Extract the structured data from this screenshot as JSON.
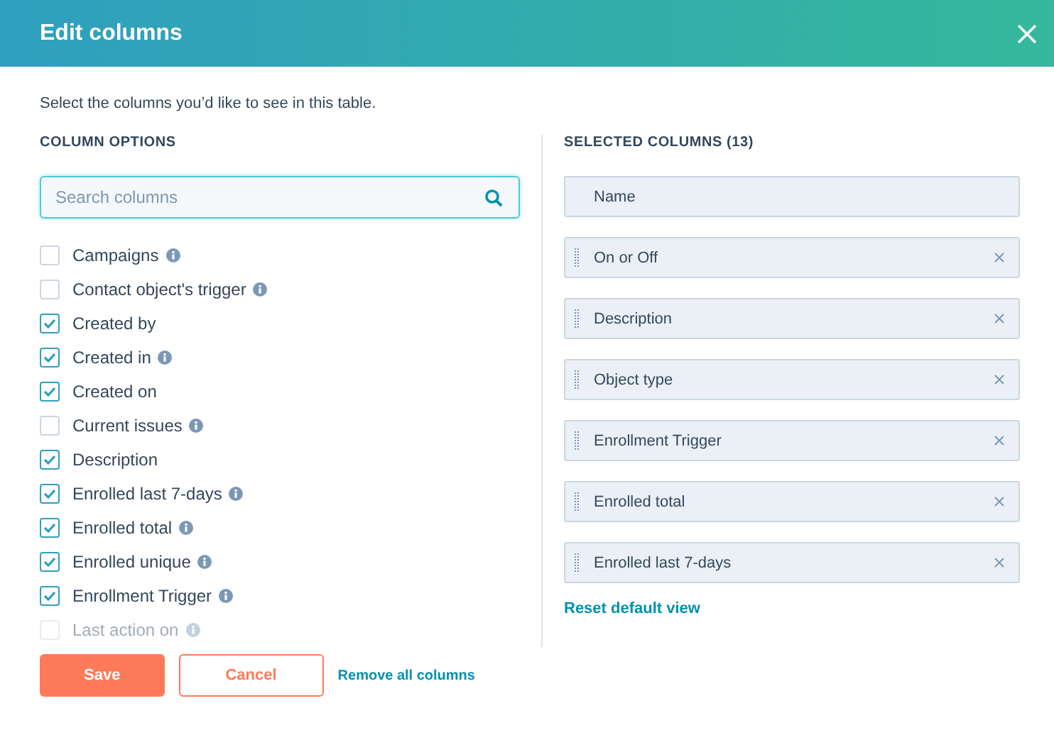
{
  "window": {
    "title": "Edit columns"
  },
  "intro": "Select the columns you’d like to see in this table.",
  "options": {
    "heading": "COLUMN OPTIONS",
    "search": {
      "placeholder": "Search columns"
    },
    "items": [
      {
        "label": "Campaigns",
        "checked": false,
        "info": true
      },
      {
        "label": "Contact object's trigger",
        "checked": false,
        "info": true
      },
      {
        "label": "Created by",
        "checked": true,
        "info": false
      },
      {
        "label": "Created in",
        "checked": true,
        "info": true
      },
      {
        "label": "Created on",
        "checked": true,
        "info": false
      },
      {
        "label": "Current issues",
        "checked": false,
        "info": true
      },
      {
        "label": "Description",
        "checked": true,
        "info": false
      },
      {
        "label": "Enrolled last 7-days",
        "checked": true,
        "info": true
      },
      {
        "label": "Enrolled total",
        "checked": true,
        "info": true
      },
      {
        "label": "Enrolled unique",
        "checked": true,
        "info": true
      },
      {
        "label": "Enrollment Trigger",
        "checked": true,
        "info": true
      },
      {
        "label": "Last action on",
        "checked": false,
        "info": true
      }
    ]
  },
  "selected": {
    "heading": "SELECTED COLUMNS (13)",
    "items": [
      {
        "label": "Name",
        "kind": "fixed"
      },
      {
        "label": "On or Off",
        "kind": "movable"
      },
      {
        "label": "Description",
        "kind": "movable"
      },
      {
        "label": "Object type",
        "kind": "movable"
      },
      {
        "label": "Enrollment Trigger",
        "kind": "movable"
      },
      {
        "label": "Enrolled total",
        "kind": "movable"
      },
      {
        "label": "Enrolled last 7-days",
        "kind": "movable"
      }
    ],
    "reset": "Reset default view"
  },
  "footer": {
    "save": "Save",
    "cancel": "Cancel",
    "remove_all": "Remove all columns"
  }
}
